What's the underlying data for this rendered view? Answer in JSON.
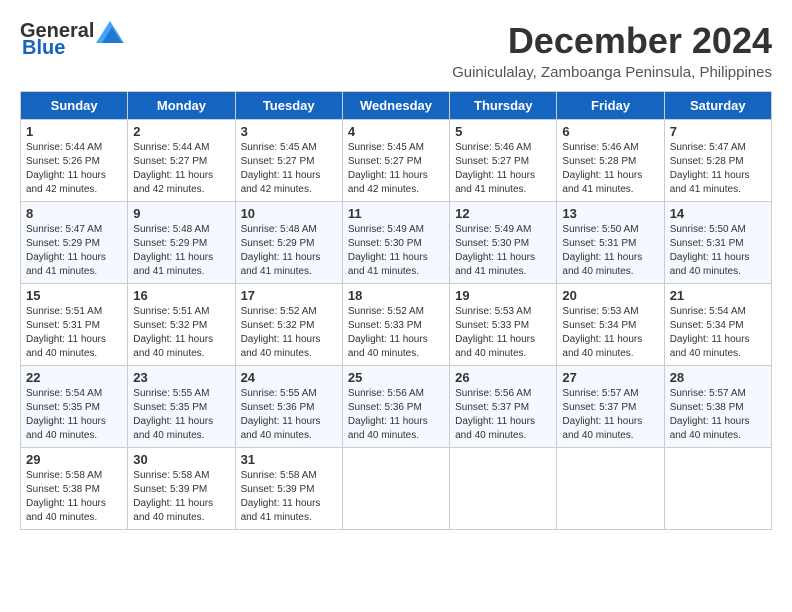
{
  "header": {
    "logo_general": "General",
    "logo_blue": "Blue",
    "month_title": "December 2024",
    "subtitle": "Guiniculalay, Zamboanga Peninsula, Philippines"
  },
  "days_of_week": [
    "Sunday",
    "Monday",
    "Tuesday",
    "Wednesday",
    "Thursday",
    "Friday",
    "Saturday"
  ],
  "weeks": [
    [
      {
        "day": "1",
        "sunrise": "5:44 AM",
        "sunset": "5:26 PM",
        "daylight": "11 hours and 42 minutes."
      },
      {
        "day": "2",
        "sunrise": "5:44 AM",
        "sunset": "5:27 PM",
        "daylight": "11 hours and 42 minutes."
      },
      {
        "day": "3",
        "sunrise": "5:45 AM",
        "sunset": "5:27 PM",
        "daylight": "11 hours and 42 minutes."
      },
      {
        "day": "4",
        "sunrise": "5:45 AM",
        "sunset": "5:27 PM",
        "daylight": "11 hours and 42 minutes."
      },
      {
        "day": "5",
        "sunrise": "5:46 AM",
        "sunset": "5:27 PM",
        "daylight": "11 hours and 41 minutes."
      },
      {
        "day": "6",
        "sunrise": "5:46 AM",
        "sunset": "5:28 PM",
        "daylight": "11 hours and 41 minutes."
      },
      {
        "day": "7",
        "sunrise": "5:47 AM",
        "sunset": "5:28 PM",
        "daylight": "11 hours and 41 minutes."
      }
    ],
    [
      {
        "day": "8",
        "sunrise": "5:47 AM",
        "sunset": "5:29 PM",
        "daylight": "11 hours and 41 minutes."
      },
      {
        "day": "9",
        "sunrise": "5:48 AM",
        "sunset": "5:29 PM",
        "daylight": "11 hours and 41 minutes."
      },
      {
        "day": "10",
        "sunrise": "5:48 AM",
        "sunset": "5:29 PM",
        "daylight": "11 hours and 41 minutes."
      },
      {
        "day": "11",
        "sunrise": "5:49 AM",
        "sunset": "5:30 PM",
        "daylight": "11 hours and 41 minutes."
      },
      {
        "day": "12",
        "sunrise": "5:49 AM",
        "sunset": "5:30 PM",
        "daylight": "11 hours and 41 minutes."
      },
      {
        "day": "13",
        "sunrise": "5:50 AM",
        "sunset": "5:31 PM",
        "daylight": "11 hours and 40 minutes."
      },
      {
        "day": "14",
        "sunrise": "5:50 AM",
        "sunset": "5:31 PM",
        "daylight": "11 hours and 40 minutes."
      }
    ],
    [
      {
        "day": "15",
        "sunrise": "5:51 AM",
        "sunset": "5:31 PM",
        "daylight": "11 hours and 40 minutes."
      },
      {
        "day": "16",
        "sunrise": "5:51 AM",
        "sunset": "5:32 PM",
        "daylight": "11 hours and 40 minutes."
      },
      {
        "day": "17",
        "sunrise": "5:52 AM",
        "sunset": "5:32 PM",
        "daylight": "11 hours and 40 minutes."
      },
      {
        "day": "18",
        "sunrise": "5:52 AM",
        "sunset": "5:33 PM",
        "daylight": "11 hours and 40 minutes."
      },
      {
        "day": "19",
        "sunrise": "5:53 AM",
        "sunset": "5:33 PM",
        "daylight": "11 hours and 40 minutes."
      },
      {
        "day": "20",
        "sunrise": "5:53 AM",
        "sunset": "5:34 PM",
        "daylight": "11 hours and 40 minutes."
      },
      {
        "day": "21",
        "sunrise": "5:54 AM",
        "sunset": "5:34 PM",
        "daylight": "11 hours and 40 minutes."
      }
    ],
    [
      {
        "day": "22",
        "sunrise": "5:54 AM",
        "sunset": "5:35 PM",
        "daylight": "11 hours and 40 minutes."
      },
      {
        "day": "23",
        "sunrise": "5:55 AM",
        "sunset": "5:35 PM",
        "daylight": "11 hours and 40 minutes."
      },
      {
        "day": "24",
        "sunrise": "5:55 AM",
        "sunset": "5:36 PM",
        "daylight": "11 hours and 40 minutes."
      },
      {
        "day": "25",
        "sunrise": "5:56 AM",
        "sunset": "5:36 PM",
        "daylight": "11 hours and 40 minutes."
      },
      {
        "day": "26",
        "sunrise": "5:56 AM",
        "sunset": "5:37 PM",
        "daylight": "11 hours and 40 minutes."
      },
      {
        "day": "27",
        "sunrise": "5:57 AM",
        "sunset": "5:37 PM",
        "daylight": "11 hours and 40 minutes."
      },
      {
        "day": "28",
        "sunrise": "5:57 AM",
        "sunset": "5:38 PM",
        "daylight": "11 hours and 40 minutes."
      }
    ],
    [
      {
        "day": "29",
        "sunrise": "5:58 AM",
        "sunset": "5:38 PM",
        "daylight": "11 hours and 40 minutes."
      },
      {
        "day": "30",
        "sunrise": "5:58 AM",
        "sunset": "5:39 PM",
        "daylight": "11 hours and 40 minutes."
      },
      {
        "day": "31",
        "sunrise": "5:58 AM",
        "sunset": "5:39 PM",
        "daylight": "11 hours and 41 minutes."
      },
      null,
      null,
      null,
      null
    ]
  ]
}
